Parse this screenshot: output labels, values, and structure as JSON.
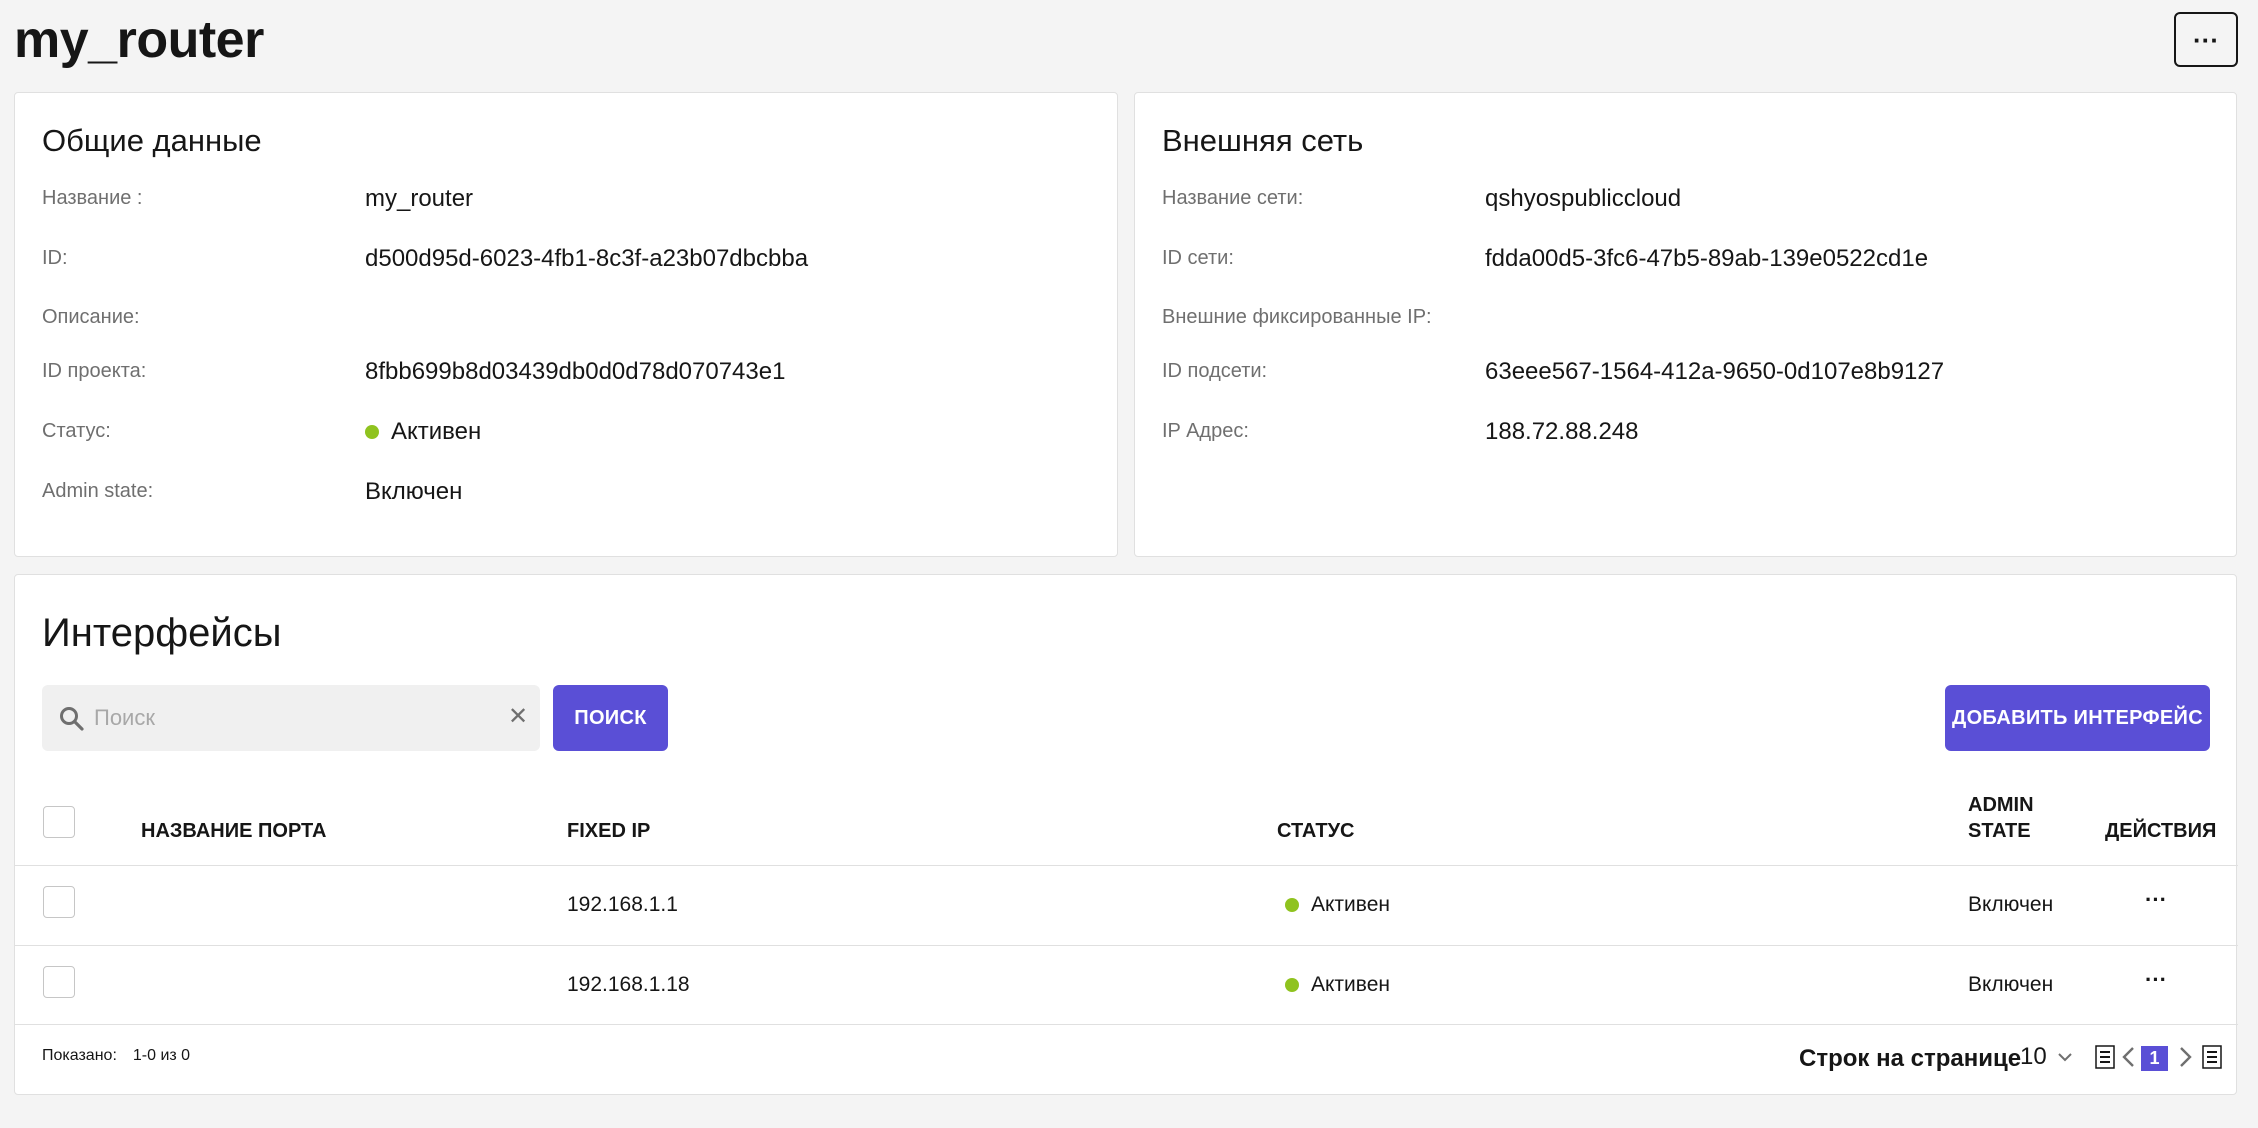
{
  "page": {
    "title": "my_router",
    "more_label": "···"
  },
  "general": {
    "heading": "Общие данные",
    "rows": [
      {
        "label": "Название :",
        "value": "my_router"
      },
      {
        "label": "ID:",
        "value": "d500d95d-6023-4fb1-8c3f-a23b07dbcbba"
      },
      {
        "label": "Описание:",
        "value": ""
      },
      {
        "label": "ID проекта:",
        "value": "8fbb699b8d03439db0d0d78d070743e1"
      },
      {
        "label": "Статус:",
        "value": "Активен"
      },
      {
        "label": "Admin state:",
        "value": "Включен"
      }
    ]
  },
  "external": {
    "heading": "Внешняя сеть",
    "rows": [
      {
        "label": "Название сети:",
        "value": "qshyospubliccloud"
      },
      {
        "label": "ID сети:",
        "value": "fdda00d5-3fc6-47b5-89ab-139e0522cd1e"
      },
      {
        "label": "Внешние фиксированные IP:",
        "value": ""
      },
      {
        "label": "ID подсети:",
        "value": "63eee567-1564-412a-9650-0d107e8b9127"
      },
      {
        "label": "IP Адрес:",
        "value": "188.72.88.248"
      }
    ]
  },
  "interfaces": {
    "title": "Интерфейсы",
    "search": {
      "placeholder": "Поиск",
      "button": "ПОИСК"
    },
    "add_button": "ДОБАВИТЬ ИНТЕРФЕЙС",
    "columns": [
      "НАЗВАНИЕ ПОРТА",
      "FIXED IP",
      "СТАТУС",
      "ADMIN STATE",
      "ДЕЙСТВИЯ"
    ],
    "rows": [
      {
        "port_name": "",
        "fixed_ip": "192.168.1.1",
        "status": "Активен",
        "admin_state": "Включен"
      },
      {
        "port_name": "",
        "fixed_ip": "192.168.1.18",
        "status": "Активен",
        "admin_state": "Включен"
      }
    ],
    "footer": {
      "shown_label": "Показано:",
      "shown_value": "1-0 из 0",
      "rows_per_page_label": "Строк на странице",
      "rows_per_page_value": "10",
      "current_page": "1"
    }
  },
  "colors": {
    "accent": "#5a4fd6",
    "status_active": "#8fc31f"
  }
}
